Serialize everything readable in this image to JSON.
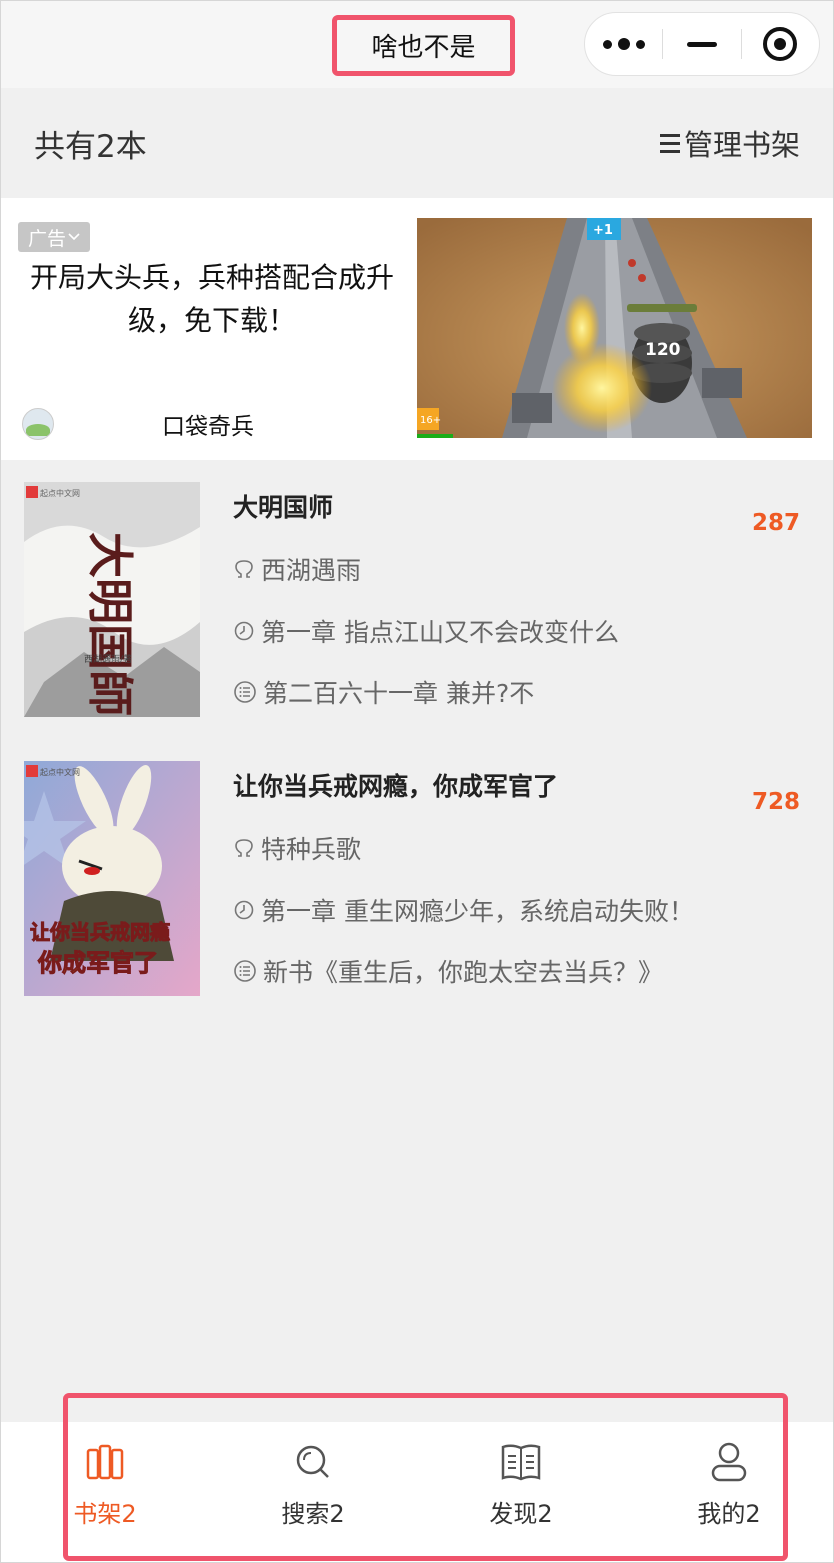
{
  "titlebar": {
    "title": "啥也不是",
    "capsule": {
      "more_icon": "more-dots-icon",
      "minimize_icon": "minimize-icon",
      "close_icon": "target-close-icon"
    }
  },
  "header": {
    "count_text": "共有2本",
    "manage_label": "管理书架"
  },
  "ad": {
    "tag_label": "广告",
    "title": "开局大头兵，兵种搭配合成升级，免下载！",
    "brand_name": "口袋奇兵",
    "image_labels": {
      "top_counter": "+1",
      "tire_counter": "120",
      "age_badge": "16+"
    }
  },
  "books": [
    {
      "title": "大明国师",
      "unread_count": "287",
      "author": "西湖遇雨",
      "last_read": "第一章 指点江山又不会改变什么",
      "latest": "第二百六十一章 兼并?不",
      "cover_badge": "起点中文网",
      "cover_text": "大明国師",
      "cover_author": "西湖遇雨/著"
    },
    {
      "title": "让你当兵戒网瘾，你成军官了",
      "unread_count": "728",
      "author": "特种兵歌",
      "last_read": "第一章 重生网瘾少年，系统启动失败！",
      "latest": "新书《重生后，你跑太空去当兵？》",
      "cover_badge": "起点中文网",
      "cover_text_top": "让你当兵戒网瘾",
      "cover_text_bottom": "你成军官了"
    }
  ],
  "tabs": [
    {
      "label": "书架2",
      "icon": "bookshelf-icon",
      "active": true
    },
    {
      "label": "搜索2",
      "icon": "search-icon",
      "active": false
    },
    {
      "label": "发现2",
      "icon": "open-book-icon",
      "active": false
    },
    {
      "label": "我的2",
      "icon": "user-icon",
      "active": false
    }
  ],
  "colors": {
    "accent": "#ee5a24",
    "highlight_outline": "#f0546c",
    "background": "#f0f0f0"
  }
}
